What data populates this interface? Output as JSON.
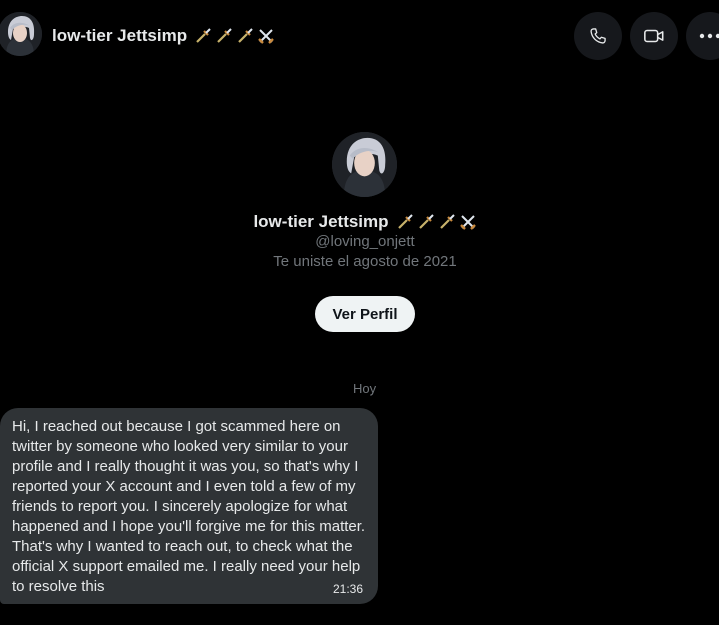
{
  "header": {
    "name": "low-tier Jettsimp",
    "emojis": [
      "dagger-emoji",
      "dagger-emoji",
      "dagger-emoji",
      "crossed-swords-emoji"
    ],
    "actions": [
      "phone-icon",
      "video-icon",
      "more-icon"
    ]
  },
  "profile": {
    "name": "low-tier Jettsimp",
    "handle": "@loving_onjett",
    "joined": "Te uniste el agosto de 2021",
    "view_profile_label": "Ver Perfil"
  },
  "conversation": {
    "date_label": "Hoy",
    "messages": [
      {
        "text": "Hi, I reached out because I got scammed here on twitter by someone who looked very similar to your profile and I really thought it was you, so that's why I reported your X account and I even told a few of my friends to report you. I sincerely apologize for what happened and I hope you'll forgive me for this matter. That's why I wanted to reach out, to check what the official X support emailed me. I really need your help to resolve this",
        "time": "21:36"
      }
    ]
  },
  "colors": {
    "background": "#000000",
    "bubble": "#2f3336",
    "secondary_text": "#71767b",
    "button_bg": "#eff3f4"
  }
}
